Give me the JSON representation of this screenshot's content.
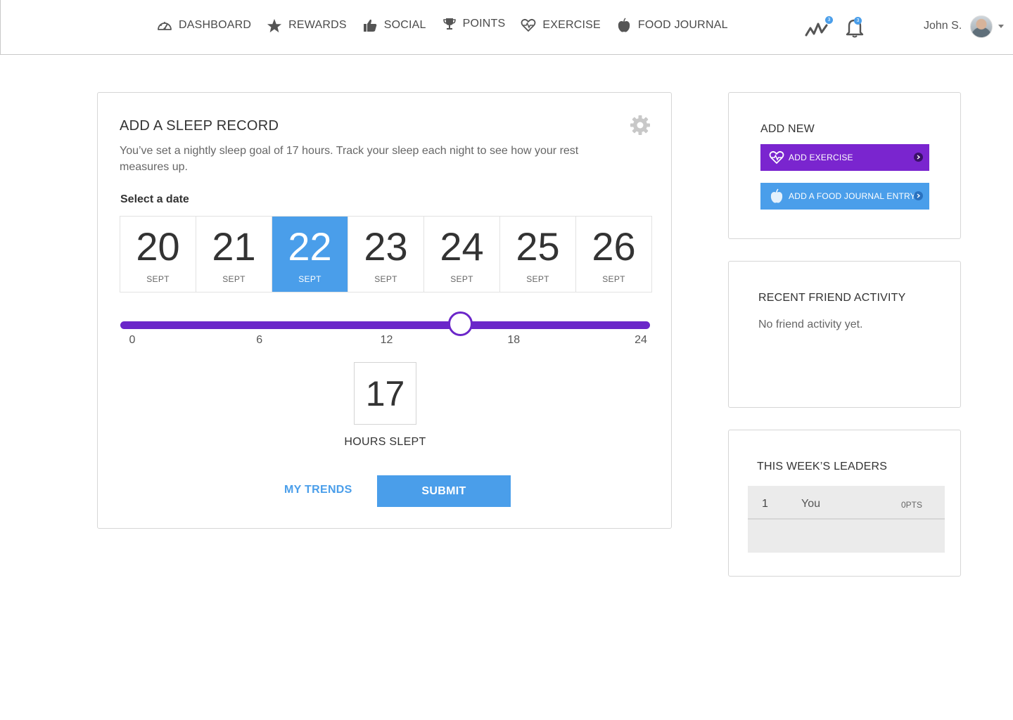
{
  "nav": {
    "items": [
      {
        "label": "DASHBOARD",
        "icon": "dashboard-gauge-icon"
      },
      {
        "label": "REWARDS",
        "icon": "star-icon"
      },
      {
        "label": "SOCIAL",
        "icon": "thumbs-up-icon"
      },
      {
        "label": "POINTS",
        "icon": "trophy-icon"
      },
      {
        "label": "EXERCISE",
        "icon": "heart-pulse-icon"
      },
      {
        "label": "FOOD JOURNAL",
        "icon": "apple-icon"
      }
    ],
    "activity_badge": "3",
    "notification_badge": "3",
    "user_name": "John S."
  },
  "sleep": {
    "title": "ADD A SLEEP RECORD",
    "description": "You’ve set a nightly sleep goal of 17 hours. Track your sleep each night to see how your rest measures up.",
    "select_label": "Select a date",
    "dates": [
      {
        "day": "20",
        "month": "SEPT"
      },
      {
        "day": "21",
        "month": "SEPT"
      },
      {
        "day": "22",
        "month": "SEPT"
      },
      {
        "day": "23",
        "month": "SEPT"
      },
      {
        "day": "24",
        "month": "SEPT"
      },
      {
        "day": "25",
        "month": "SEPT"
      },
      {
        "day": "26",
        "month": "SEPT"
      }
    ],
    "selected_index": 2,
    "slider": {
      "min": 0,
      "max": 24,
      "value": 15.5,
      "ticks": [
        "0",
        "6",
        "12",
        "18",
        "24"
      ]
    },
    "hours_value": "17",
    "hours_label": "HOURS SLEPT",
    "trends_link": "MY TRENDS",
    "submit_label": "SUBMIT",
    "accent": "#6b26c9",
    "primary": "#4a9eea"
  },
  "add_new": {
    "title": "ADD NEW",
    "exercise_label": "ADD EXERCISE",
    "food_label": "ADD A FOOD JOURNAL ENTRY"
  },
  "friends": {
    "title": "RECENT FRIEND ACTIVITY",
    "empty_text": "No friend activity yet."
  },
  "leaders": {
    "title": "THIS WEEK’S LEADERS",
    "rows": [
      {
        "rank": "1",
        "name": "You",
        "points": "0PTS"
      }
    ]
  }
}
